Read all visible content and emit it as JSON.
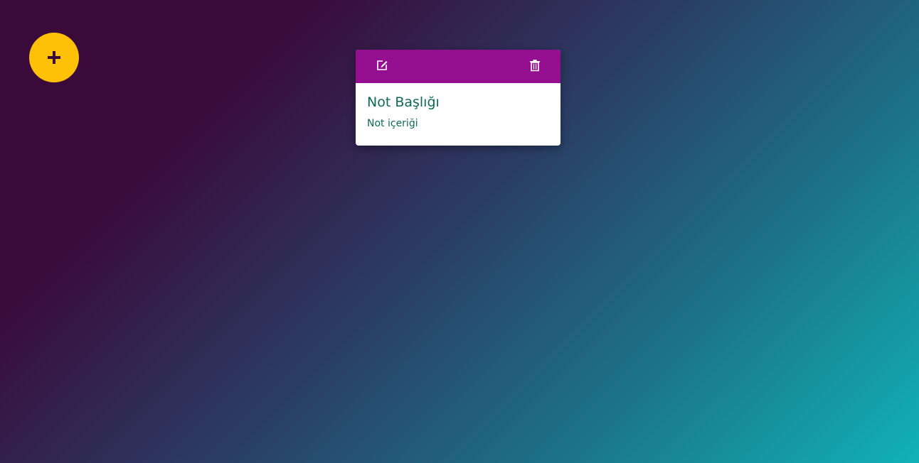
{
  "add_button": {
    "icon": "plus-icon",
    "color": "#ffc107"
  },
  "note": {
    "toolbar_color": "#930f8f",
    "edit_icon": "edit-icon",
    "delete_icon": "trash-icon",
    "title": "Not Başlığı",
    "content": "Not içeriği",
    "text_color": "#0e6b52"
  }
}
